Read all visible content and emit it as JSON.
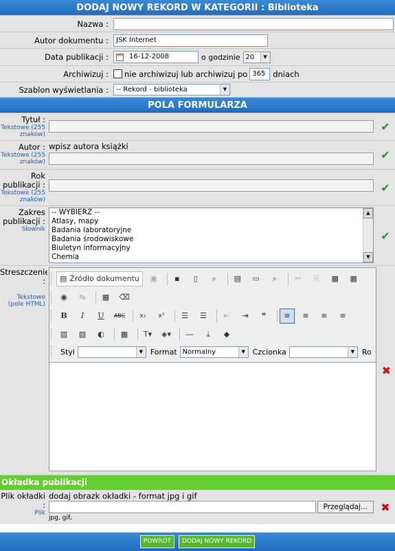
{
  "header": {
    "title": "DODAJ NOWY REKORD W KATEGORII : Biblioteka"
  },
  "meta": {
    "nazwa_label": "Nazwa :",
    "nazwa_value": "",
    "autor_label": "Autor dokumentu :",
    "autor_value": "JSK Internet",
    "data_label": "Data publikacji :",
    "data_value": "16-12-2008",
    "godzina_label": "o godzinie",
    "godzina_value": "20",
    "archiwizuj_label": "Archiwizuj :",
    "archiwizuj_text": "nie archiwizuj lub archiwizuj po",
    "archiwizuj_days": "365",
    "archiwizuj_unit": "dniach",
    "szablon_label": "Szablon wyświetlania :",
    "szablon_value": "-- Rekord - biblioteka"
  },
  "section_fields": {
    "title": "POLA FORMULARZA"
  },
  "fields": {
    "tytul": {
      "label": "Tytuł :",
      "type": "Tekstowe (255 znaków)",
      "value": ""
    },
    "autor": {
      "label": "Autor :",
      "type": "Tekstowe (255 znaków)",
      "hint": "wpisz autora książki",
      "value": ""
    },
    "rok": {
      "label": "Rok publikacji :",
      "type": "Tekstowe (255 znaków)",
      "value": ""
    },
    "zakres": {
      "label": "Zakres publikacji :",
      "type": "Słownik",
      "options": [
        "-- WYBIERZ --",
        "Atlasy, mapy",
        "Badania laboratoryjne",
        "Badania środowiskowe",
        "Biuletyn informacyjny",
        "Chemia"
      ]
    },
    "streszczenie": {
      "label": "Streszczenie :",
      "type": "Tekstowe (pole HTML)"
    }
  },
  "editor": {
    "source_label": "Źródło dokumentu",
    "styl_label": "Styl",
    "styl_value": "",
    "format_label": "Format",
    "format_value": "Normalny",
    "czcionka_label": "Czcionka",
    "czcionka_value": "",
    "rozmiar_label": "Ro"
  },
  "section_cover": {
    "title": "Okładka publikacji"
  },
  "cover": {
    "label": "Plik okładki :",
    "type": "Plik",
    "hint": "dodaj obrazk okładki - format jpg i gif",
    "browse_label": "Przeglądaj...",
    "formats": "jpg, gif,"
  },
  "footer": {
    "back_label": "POWRÓT",
    "submit_label": "DODAJ NOWY REKORD"
  },
  "status": {
    "ok_icon": "checkmark-icon",
    "error_icon": "cross-icon"
  }
}
